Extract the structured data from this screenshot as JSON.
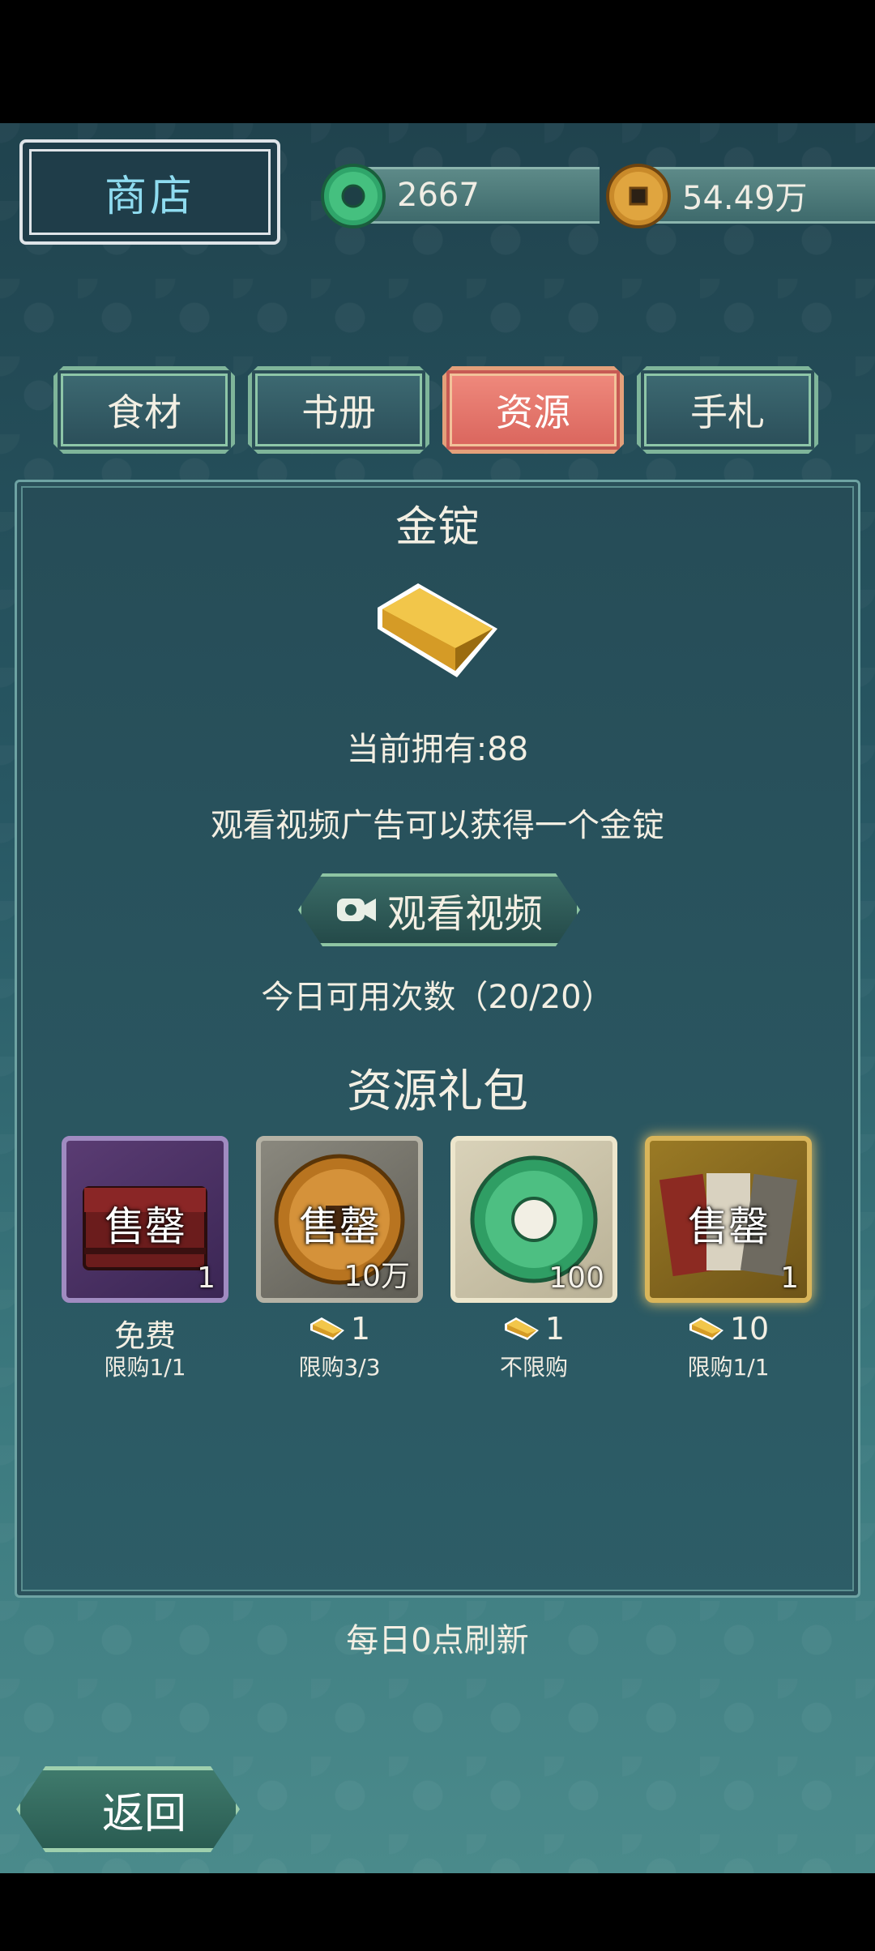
{
  "header": {
    "title": "商店"
  },
  "currency": {
    "jade": "2667",
    "coins": "54.49万"
  },
  "tabs": [
    {
      "label": "食材",
      "active": false
    },
    {
      "label": "书册",
      "active": false
    },
    {
      "label": "资源",
      "active": true
    },
    {
      "label": "手札",
      "active": false
    }
  ],
  "item": {
    "name": "金锭",
    "owned": "当前拥有:88",
    "description": "观看视频广告可以获得一个金锭",
    "watch_button": "观看视频",
    "daily_uses": "今日可用次数（20/20）"
  },
  "packs_title": "资源礼包",
  "packs": [
    {
      "icon": "chest-icon",
      "sale": "售罄",
      "count": "1",
      "price": "免费",
      "limit": "限购1/1"
    },
    {
      "icon": "copper-coin-icon",
      "sale": "售罄",
      "count": "10万",
      "price": "1",
      "limit": "限购3/3"
    },
    {
      "icon": "jade-disc-icon",
      "sale": "",
      "count": "100",
      "price": "1",
      "limit": "不限购"
    },
    {
      "icon": "scroll-book-icon",
      "sale": "售罄",
      "count": "1",
      "price": "10",
      "limit": "限购1/1"
    }
  ],
  "refresh_note": "每日0点刷新",
  "back_button": "返回",
  "colors": {
    "active_tab": "#e0766c",
    "tab_border": "#8ec6a8",
    "title_text": "#8fdcf0"
  }
}
